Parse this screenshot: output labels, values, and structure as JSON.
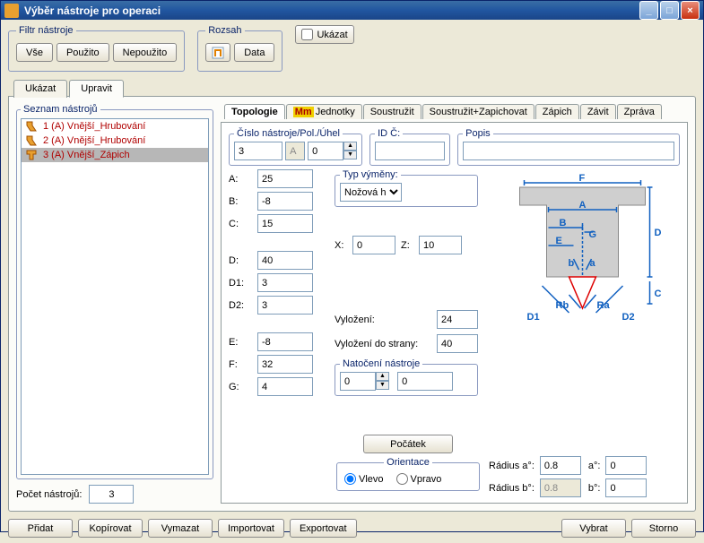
{
  "window": {
    "title": "Výběr nástroje pro operaci"
  },
  "filter_group": {
    "legend": "Filtr nástroje",
    "all": "Vše",
    "used": "Použito",
    "unused": "Nepoužito"
  },
  "range_group": {
    "legend": "Rozsah",
    "data_btn": "Data"
  },
  "show_chk": "Ukázat",
  "tabs": {
    "show": "Ukázat",
    "edit": "Upravit"
  },
  "list_legend": "Seznam nástrojů",
  "tools": [
    {
      "label": "1 (A)  Vnější_Hrubování"
    },
    {
      "label": "2 (A)  Vnější_Hrubování"
    },
    {
      "label": "3 (A)  Vnější_Zápich"
    }
  ],
  "count_label": "Počet nástrojů:",
  "count_value": "3",
  "subtabs": {
    "topology": "Topologie",
    "units": "Jednotky",
    "turn": "Soustružit",
    "turngroove": "Soustružit+Zapichovat",
    "groove": "Zápich",
    "thread": "Závit",
    "report": "Zpráva"
  },
  "idrow": {
    "num_legend": "Číslo nástroje/Pol./Úhel",
    "num": "3",
    "polA": "A",
    "polVal": "0",
    "idc_legend": "ID Č:",
    "idc": "",
    "desc_legend": "Popis",
    "desc": ""
  },
  "params": {
    "A_l": "A:",
    "A": "25",
    "B_l": "B:",
    "B": "-8",
    "C_l": "C:",
    "C": "15",
    "D_l": "D:",
    "D": "40",
    "D1_l": "D1:",
    "D1": "3",
    "D2_l": "D2:",
    "D2": "3",
    "E_l": "E:",
    "E": "-8",
    "F_l": "F:",
    "F": "32",
    "G_l": "G:",
    "G": "4"
  },
  "exchange": {
    "legend": "Typ výměny:",
    "value": "Nožová h"
  },
  "xz": {
    "X_l": "X:",
    "X": "0",
    "Z_l": "Z:",
    "Z": "10"
  },
  "over": {
    "label": "Vyložení:",
    "value": "24",
    "side_label": "Vyložení do strany:",
    "side": "40"
  },
  "rot": {
    "legend": "Natočení nástroje",
    "v1": "0",
    "v2": "0"
  },
  "origin_btn": "Počátek",
  "orient": {
    "legend": "Orientace",
    "left": "Vlevo",
    "right": "Vpravo"
  },
  "radii": {
    "ra_l": "Rádius a°:",
    "ra": "0.8",
    "rb_l": "Rádius b°:",
    "rb": "0.8",
    "a_l": "a°:",
    "a": "0",
    "b_l": "b°:",
    "b": "0"
  },
  "footer": {
    "add": "Přidat",
    "copy": "Kopírovat",
    "del": "Vymazat",
    "imp": "Importovat",
    "exp": "Exportovat",
    "select": "Vybrat",
    "cancel": "Storno"
  },
  "diagram_labels": {
    "F": "F",
    "A": "A",
    "B": "B",
    "E": "E",
    "G": "G",
    "b": "b",
    "a": "a",
    "D": "D",
    "C": "C",
    "D1": "D1",
    "D2": "D2",
    "Rb": "Rb",
    "Ra": "Ra"
  }
}
